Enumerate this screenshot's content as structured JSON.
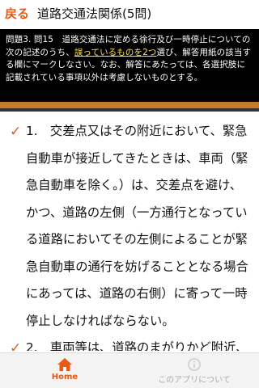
{
  "header": {
    "back_label": "戻る",
    "title": "道路交通法関係(5問)"
  },
  "question": {
    "intro": "問題3. 問15　道路交通法に定める徐行及び一時停止についての次の記述のうち、",
    "highlight": "誤っているものを2つ",
    "outro": "選び、解答用紙の該当する欄にマークしなさい。なお、解答にあたっては、各選択肢に記載されている事項以外は考慮しないものとする。"
  },
  "progress": {
    "value": 0.0
  },
  "choices": [
    {
      "number": "1.",
      "text": "交差点又はその附近において、緊急自動車が接近してきたときは、車両（緊急自動車を除く。）は、交差点を避け、かつ、道路の左側（一方通行となっている道路においてその左側によることが緊急自動車の通行を妨げることとなる場合にあっては、道路の右側）に寄って一時停止しなければならない。"
    },
    {
      "number": "2.",
      "text": "車両等は、道路のまがりかど附近、"
    }
  ],
  "tabs": {
    "home_label": "Home",
    "about_label": "このアプリについて"
  },
  "colors": {
    "accent": "#e85a14",
    "panel": "#000000",
    "progress": "#c37a2b"
  }
}
